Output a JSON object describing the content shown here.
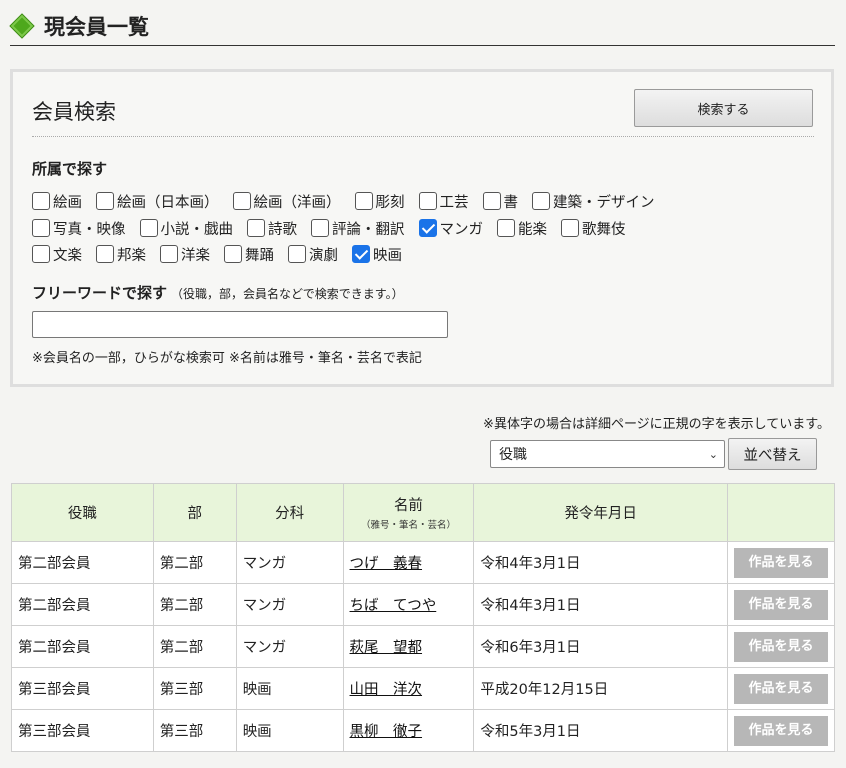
{
  "header": {
    "title": "現会員一覧",
    "icon": "diamond-icon",
    "icon_color": "#4ea81c"
  },
  "search": {
    "heading": "会員検索",
    "button_label": "検索する",
    "affiliation_label": "所属で探す",
    "checkbox_rows": [
      [
        {
          "label": "絵画",
          "checked": false
        },
        {
          "label": "絵画（日本画）",
          "checked": false
        },
        {
          "label": "絵画（洋画）",
          "checked": false
        },
        {
          "label": "彫刻",
          "checked": false
        },
        {
          "label": "工芸",
          "checked": false
        },
        {
          "label": "書",
          "checked": false
        },
        {
          "label": "建築・デザイン",
          "checked": false
        }
      ],
      [
        {
          "label": "写真・映像",
          "checked": false
        },
        {
          "label": "小説・戯曲",
          "checked": false
        },
        {
          "label": "詩歌",
          "checked": false
        },
        {
          "label": "評論・翻訳",
          "checked": false
        },
        {
          "label": "マンガ",
          "checked": true
        },
        {
          "label": "能楽",
          "checked": false
        },
        {
          "label": "歌舞伎",
          "checked": false
        }
      ],
      [
        {
          "label": "文楽",
          "checked": false
        },
        {
          "label": "邦楽",
          "checked": false
        },
        {
          "label": "洋楽",
          "checked": false
        },
        {
          "label": "舞踊",
          "checked": false
        },
        {
          "label": "演劇",
          "checked": false
        },
        {
          "label": "映画",
          "checked": true
        }
      ]
    ],
    "freeword_label": "フリーワードで探す",
    "freeword_note": "（役職，部，会員名などで検索できます。）",
    "freeword_value": "",
    "hint": "※会員名の一部，ひらがな検索可 ※名前は雅号・筆名・芸名で表記"
  },
  "variant_note": "※異体字の場合は詳細ページに正規の字を表示しています。",
  "sort": {
    "selected": "役職",
    "button_label": "並べ替え"
  },
  "table": {
    "headers": [
      "役職",
      "部",
      "分科",
      "名前",
      "発令年月日",
      ""
    ],
    "name_sub": "（雅号・筆名・芸名）",
    "rows": [
      {
        "role": "第二部会員",
        "dept": "第二部",
        "branch": "マンガ",
        "name": "つげ　義春",
        "date": "令和4年3月1日",
        "action": "作品を見る"
      },
      {
        "role": "第二部会員",
        "dept": "第二部",
        "branch": "マンガ",
        "name": "ちば　てつや",
        "date": "令和4年3月1日",
        "action": "作品を見る"
      },
      {
        "role": "第二部会員",
        "dept": "第二部",
        "branch": "マンガ",
        "name": "萩尾　望都",
        "date": "令和6年3月1日",
        "action": "作品を見る"
      },
      {
        "role": "第三部会員",
        "dept": "第三部",
        "branch": "映画",
        "name": "山田　洋次",
        "date": "平成20年12月15日",
        "action": "作品を見る"
      },
      {
        "role": "第三部会員",
        "dept": "第三部",
        "branch": "映画",
        "name": "黒柳　徹子",
        "date": "令和5年3月1日",
        "action": "作品を見る"
      }
    ]
  }
}
